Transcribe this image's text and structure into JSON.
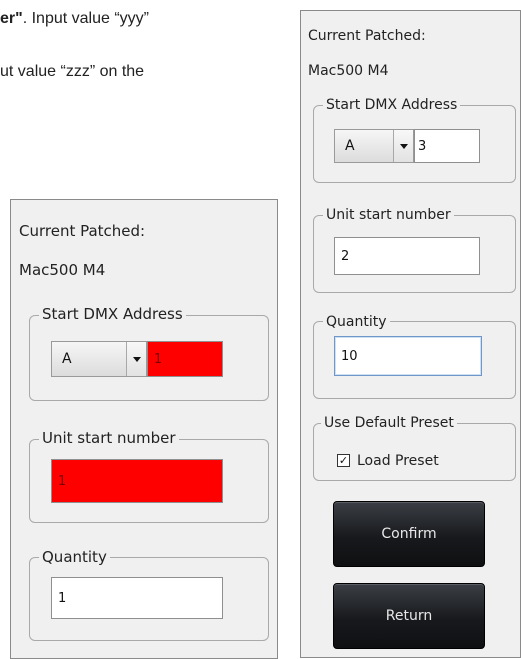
{
  "doc": {
    "line1_bold": "er\"",
    "line1_rest": ". Input value “yyy”",
    "line2": "ut value “zzz” on the"
  },
  "left_panel": {
    "current_patched_label": "Current Patched:",
    "fixture_name": "Mac500 M4",
    "start_dmx_legend": "Start DMX Address",
    "universe_value": "A",
    "address_value": "1",
    "unit_start_legend": "Unit start number",
    "unit_start_value": "1",
    "quantity_legend": "Quantity",
    "quantity_value": "1",
    "colors": {
      "error_fill": "#ff0000"
    }
  },
  "right_panel": {
    "current_patched_label": "Current Patched:",
    "fixture_name": "Mac500 M4",
    "start_dmx_legend": "Start DMX Address",
    "universe_value": "A",
    "address_value": "3",
    "unit_start_legend": "Unit start number",
    "unit_start_value": "2",
    "quantity_legend": "Quantity",
    "quantity_value": "10",
    "preset_legend": "Use Default Preset",
    "load_preset_label": "Load Preset",
    "load_preset_checked": "✓",
    "confirm_label": "Confirm",
    "return_label": "Return"
  }
}
